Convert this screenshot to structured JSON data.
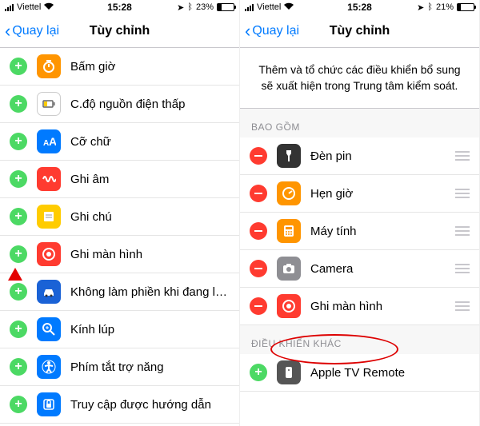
{
  "left": {
    "status": {
      "carrier": "Viettel",
      "time": "15:28",
      "battery_pct": "23%",
      "battery_fill": 23
    },
    "nav": {
      "back": "Quay lại",
      "title": "Tùy chỉnh"
    },
    "items": [
      {
        "label": "Bấm giờ",
        "icon": "stopwatch",
        "color": "ic-orange"
      },
      {
        "label": "C.độ nguồn điện thấp",
        "icon": "lowpower",
        "color": "ic-white"
      },
      {
        "label": "Cỡ chữ",
        "icon": "textsize",
        "color": "ic-blue"
      },
      {
        "label": "Ghi âm",
        "icon": "voice",
        "color": "ic-red"
      },
      {
        "label": "Ghi chú",
        "icon": "note",
        "color": "ic-yellow"
      },
      {
        "label": "Ghi màn hình",
        "icon": "screenrecord",
        "color": "ic-red"
      },
      {
        "label": "Không làm phiền khi đang lái xe",
        "icon": "car",
        "color": "ic-darkblue"
      },
      {
        "label": "Kính lúp",
        "icon": "magnify",
        "color": "ic-blue"
      },
      {
        "label": "Phím tắt trợ năng",
        "icon": "access",
        "color": "ic-blue"
      },
      {
        "label": "Truy cập được hướng dẫn",
        "icon": "guided",
        "color": "ic-blue"
      }
    ]
  },
  "right": {
    "status": {
      "carrier": "Viettel",
      "time": "15:28",
      "battery_pct": "21%",
      "battery_fill": 21
    },
    "nav": {
      "back": "Quay lại",
      "title": "Tùy chỉnh"
    },
    "intro": "Thêm và tổ chức các điều khiển bổ sung sẽ xuất hiện trong Trung tâm kiểm soát.",
    "section_included": "BAO GỒM",
    "section_more": "ĐIỀU KHIỂN KHÁC",
    "included": [
      {
        "label": "Đèn pin",
        "icon": "flashlight",
        "color": "ic-black"
      },
      {
        "label": "Hẹn giờ",
        "icon": "timer",
        "color": "ic-orange"
      },
      {
        "label": "Máy tính",
        "icon": "calc",
        "color": "ic-orange"
      },
      {
        "label": "Camera",
        "icon": "camera",
        "color": "ic-grey"
      },
      {
        "label": "Ghi màn hình",
        "icon": "screenrecord",
        "color": "ic-red"
      }
    ],
    "more": [
      {
        "label": "Apple TV Remote",
        "icon": "remote",
        "color": "ic-dark"
      }
    ]
  }
}
